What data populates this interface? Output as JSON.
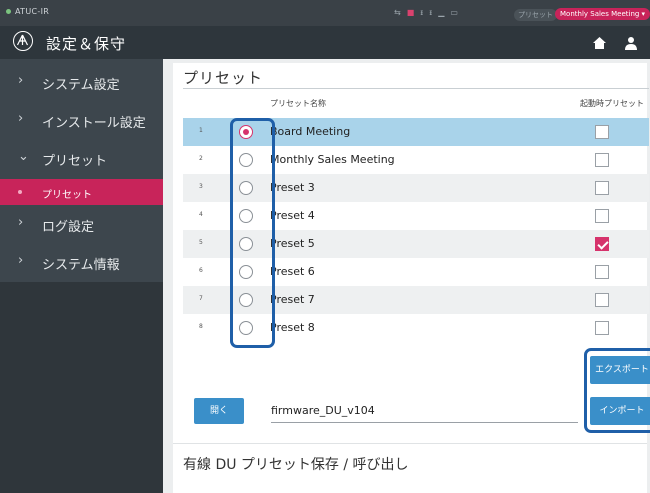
{
  "status_bar": {
    "device": "ATUC-IR",
    "preset_label": "プリセット",
    "current_preset": "Monthly Sales Meeting ▾"
  },
  "header": {
    "title": "設定＆保守",
    "logo_icon": "audio-technica-logo-icon",
    "home_icon": "home-icon",
    "user_icon": "user-icon"
  },
  "sidebar": {
    "items": [
      {
        "label": "システム設定",
        "icon": "chevron-right-icon"
      },
      {
        "label": "インストール設定",
        "icon": "chevron-right-icon"
      },
      {
        "label": "プリセット",
        "icon": "chevron-down-icon"
      },
      {
        "label": "ログ設定",
        "icon": "chevron-right-icon"
      },
      {
        "label": "システム情報",
        "icon": "chevron-right-icon"
      }
    ],
    "subitem": {
      "label": "プリセット"
    }
  },
  "main": {
    "title": "プリセット",
    "columns": {
      "name": "プリセット名称",
      "startup": "起動時プリセット"
    },
    "rows": [
      {
        "num": "1",
        "name": "Board Meeting",
        "selected": true,
        "startup": false
      },
      {
        "num": "2",
        "name": "Monthly Sales Meeting",
        "selected": false,
        "startup": false
      },
      {
        "num": "3",
        "name": "Preset 3",
        "selected": false,
        "startup": false
      },
      {
        "num": "4",
        "name": "Preset 4",
        "selected": false,
        "startup": false
      },
      {
        "num": "5",
        "name": "Preset 5",
        "selected": false,
        "startup": true
      },
      {
        "num": "6",
        "name": "Preset 6",
        "selected": false,
        "startup": false
      },
      {
        "num": "7",
        "name": "Preset 7",
        "selected": false,
        "startup": false
      },
      {
        "num": "8",
        "name": "Preset 8",
        "selected": false,
        "startup": false
      }
    ],
    "export_label": "エクスポート",
    "import_label": "インポート",
    "open_label": "開く",
    "file_name": "firmware_DU_v104",
    "section2_title": "有線 DU プリセット保存 / 呼び出し"
  },
  "colors": {
    "accent": "#c8245a",
    "button_blue": "#3a8fc9",
    "highlight_blue": "#1f5fa8",
    "selected_row": "#a9d3ea"
  }
}
